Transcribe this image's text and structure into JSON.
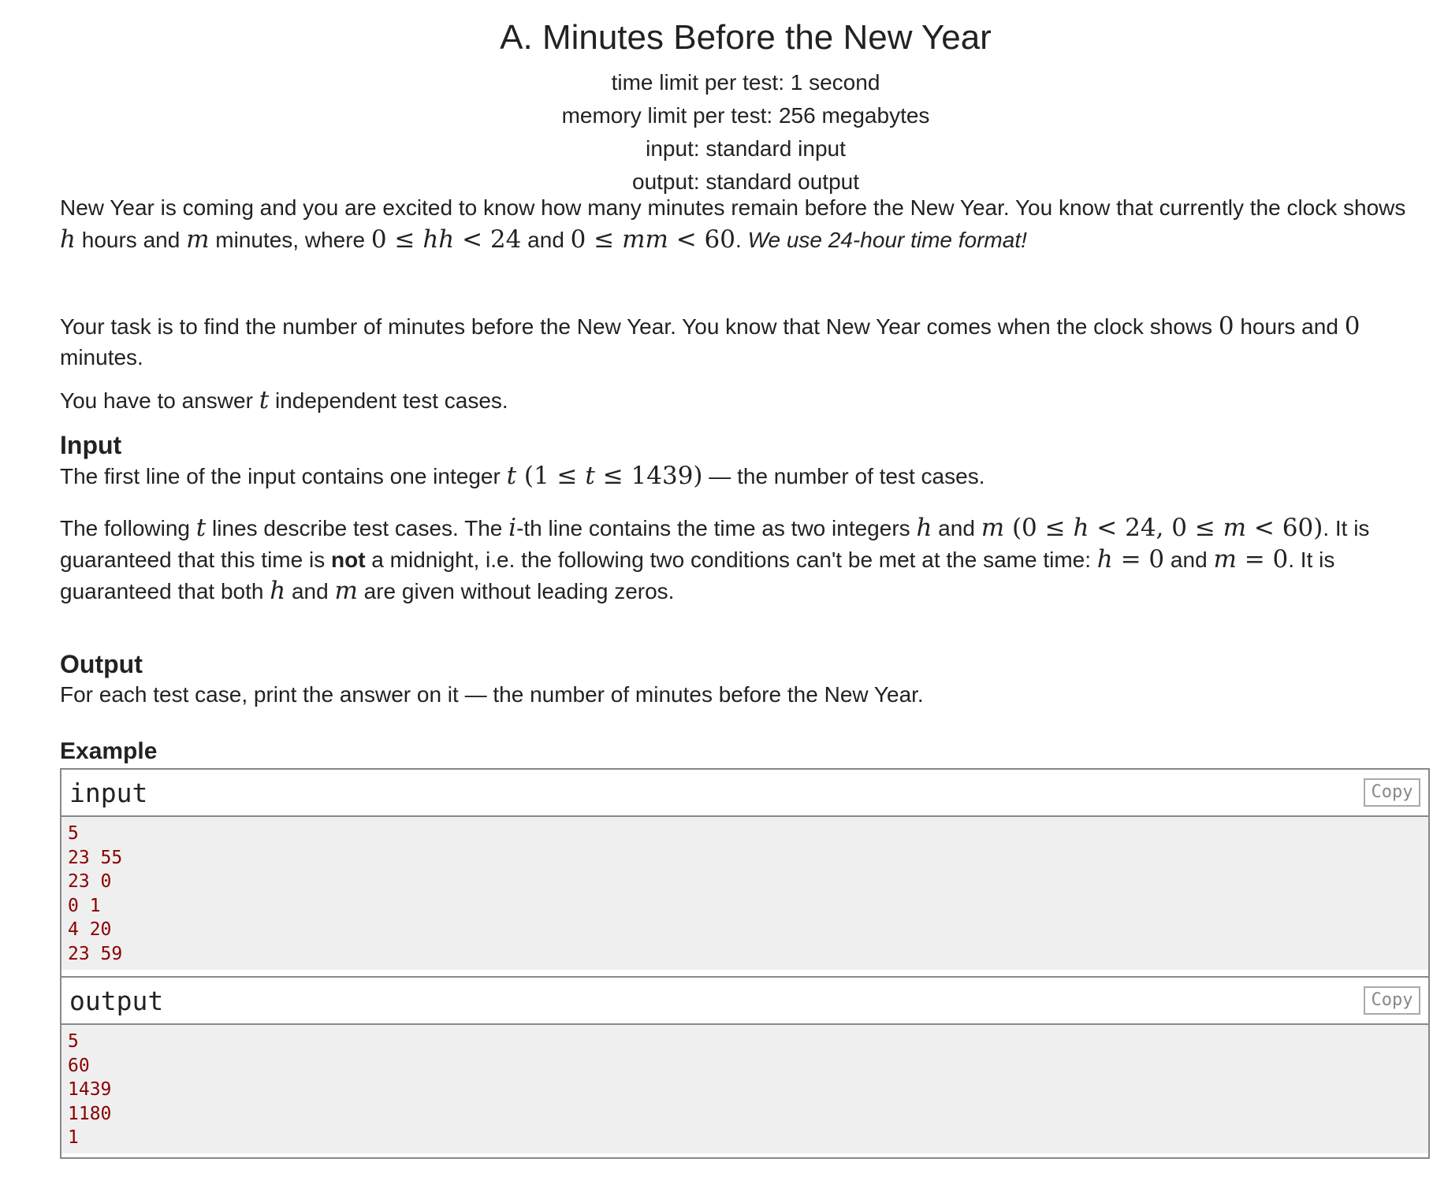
{
  "problem": {
    "title": "A. Minutes Before the New Year",
    "limits": [
      "time limit per test: 1 second",
      "memory limit per test: 256 megabytes",
      "input: standard input",
      "output: standard output"
    ]
  },
  "statement": {
    "p1": {
      "text1": "New Year is coming and you are excited to know how many minutes remain before the New Year. You know that currently the clock shows",
      "var_h": "h",
      "text2": " hours and ",
      "var_m": "m",
      "text3": " minutes, where ",
      "math1a": "0 ≤ ",
      "math1b": "hh",
      "math1c": " < 24",
      "text4": " and ",
      "math2a": "0 ≤ ",
      "math2b": "mm",
      "math2c": " < 60",
      "text5": ". ",
      "italic": "We use 24-hour time format!"
    },
    "p2": {
      "text1": "Your task is to find the number of minutes before the New Year. You know that New Year comes when the clock shows ",
      "zero1": "0",
      "text2": " hours and ",
      "zero2": "0",
      "text3": "minutes."
    },
    "p3": {
      "text1": "You have to answer ",
      "var_t": "t",
      "text2": " independent test cases."
    }
  },
  "input_section": {
    "title": "Input",
    "p1": {
      "text1": "The first line of the input contains one integer ",
      "var_t": "t",
      "math_a": " (1 ≤ ",
      "math_t": "t",
      "math_b": " ≤ 1439)",
      "text2": " — the number of test cases."
    },
    "p2": {
      "text1": "The following ",
      "var_t": "t",
      "text2": " lines describe test cases. The ",
      "var_i": "i",
      "text3": "-th line contains the time as two integers ",
      "var_h": "h",
      "text4": " and ",
      "var_m": "m",
      "math_a": " (0 ≤ ",
      "math_h": "h",
      "math_b": " < 24, 0 ≤ ",
      "math_m": "m",
      "math_c": " < 60)",
      "text5": ". It is",
      "text6": "guaranteed that this time is ",
      "bold": "not",
      "text7": " a midnight, i.e. the following two conditions can't be met at the same time: ",
      "eq1_h": "h",
      "eq1_rest": " = 0",
      "text8": " and ",
      "eq2_m": "m",
      "eq2_rest": " = 0",
      "text9": ". It is",
      "text10": "guaranteed that both ",
      "var_h2": "h",
      "text11": " and ",
      "var_m2": "m",
      "text12": " are given without leading zeros."
    }
  },
  "output_section": {
    "title": "Output",
    "text": "For each test case, print the answer on it — the number of minutes before the New Year."
  },
  "example": {
    "title": "Example",
    "input_label": "input",
    "output_label": "output",
    "copy_label": "Copy",
    "input_lines": [
      "5",
      "23 55",
      "23 0",
      "0 1",
      "4 20",
      "23 59"
    ],
    "output_lines": [
      "5",
      "60",
      "1439",
      "1180",
      "1"
    ]
  }
}
